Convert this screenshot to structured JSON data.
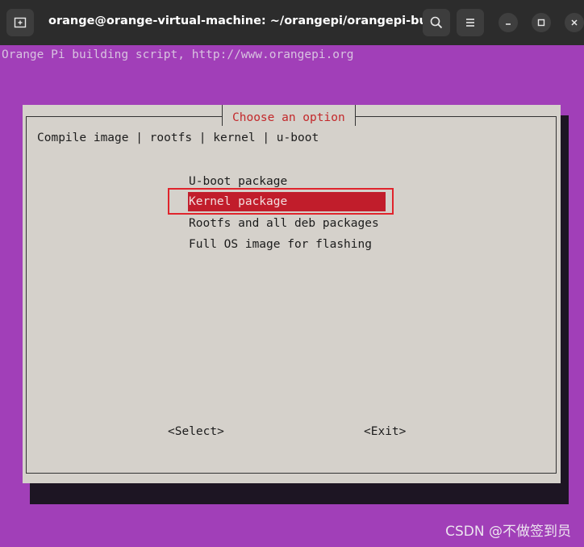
{
  "window": {
    "title": "orange@orange-virtual-machine: ~/orangepi/orangepi-build"
  },
  "terminal": {
    "header_line": "Orange Pi building script, http://www.orangepi.org"
  },
  "dialog": {
    "title": "Choose an option",
    "prompt": "Compile image | rootfs | kernel | u-boot",
    "menu_items": [
      {
        "label": "U-boot package"
      },
      {
        "label": "Kernel package"
      },
      {
        "label": "Rootfs and all deb packages"
      },
      {
        "label": "Full OS image for flashing"
      }
    ],
    "selected_index": 1,
    "select_button": "<Select>",
    "exit_button": "<Exit>"
  },
  "watermark": "CSDN @不做签到员",
  "colors": {
    "terminal_background": "#a13fb8",
    "dialog_background": "#d5d1cb",
    "selection": "#c11d2b",
    "dialog_title": "#c3282b"
  }
}
